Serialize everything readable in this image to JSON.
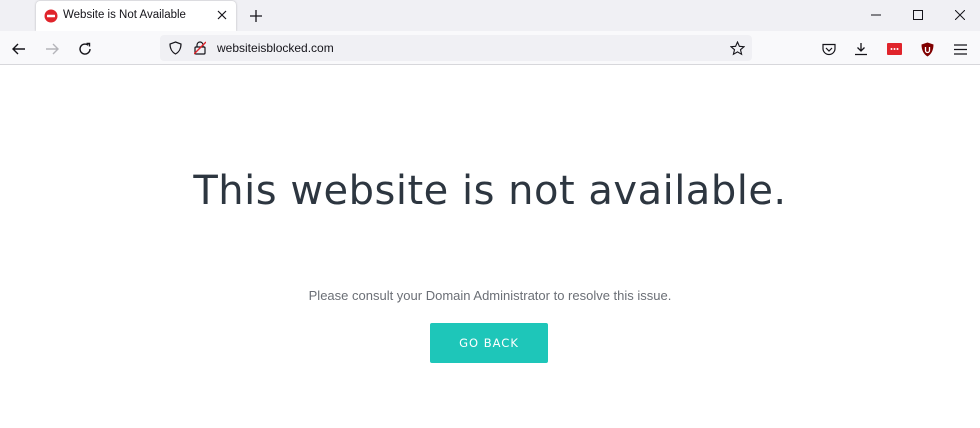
{
  "tab": {
    "title": "Website is Not Available",
    "favicon": "blocked-icon"
  },
  "address_bar": {
    "url": "websiteisblocked.com"
  },
  "toolbar_icons": [
    "back-icon",
    "forward-icon",
    "reload-icon",
    "shield-icon",
    "insecure-lock-icon",
    "bookmark-star-icon",
    "pocket-icon",
    "download-icon",
    "extension-icon",
    "ublock-icon",
    "menu-icon"
  ],
  "page": {
    "heading": "This website is not available.",
    "message": "Please consult your Domain Administrator to resolve this issue.",
    "button_label": "GO BACK"
  },
  "colors": {
    "accent_button": "#1ec6b9",
    "heading": "#2d3640",
    "favicon_red": "#e0242b"
  }
}
